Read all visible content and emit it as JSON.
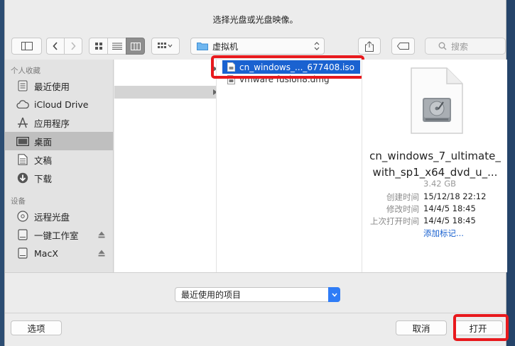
{
  "dialog": {
    "title": "选择光盘或光盘映像。"
  },
  "toolbar": {
    "location": "虚拟机",
    "search_placeholder": "搜索"
  },
  "sidebar": {
    "favorites_header": "个人收藏",
    "favorites": [
      {
        "label": "最近使用",
        "icon": "recents-icon"
      },
      {
        "label": "iCloud Drive",
        "icon": "cloud-icon"
      },
      {
        "label": "应用程序",
        "icon": "applications-icon"
      },
      {
        "label": "桌面",
        "icon": "desktop-icon",
        "selected": true
      },
      {
        "label": "文稿",
        "icon": "documents-icon"
      },
      {
        "label": "下载",
        "icon": "downloads-icon"
      }
    ],
    "devices_header": "设备",
    "devices": [
      {
        "label": "远程光盘",
        "icon": "disc-icon"
      },
      {
        "label": "一键工作室",
        "icon": "drive-icon",
        "ejectable": true
      },
      {
        "label": "MacX",
        "icon": "drive-icon",
        "ejectable": true
      }
    ]
  },
  "columns": {
    "files": [
      {
        "name": "cn_windows_..._677408.iso",
        "selected": true
      },
      {
        "name": "vmware fusion8.dmg",
        "selected": false
      }
    ]
  },
  "preview": {
    "name_line1": "cn_windows_7_ultimate_",
    "name_line2": "with_sp1_x64_dvd_u_...",
    "size": "3.42 GB",
    "created_label": "创建时间",
    "created_value": "15/12/18 22:12",
    "modified_label": "修改时间",
    "modified_value": "14/4/5 18:45",
    "opened_label": "上次打开时间",
    "opened_value": "14/4/5 18:45",
    "add_tags": "添加标记..."
  },
  "format": {
    "selected": "最近使用的项目"
  },
  "buttons": {
    "options": "选项",
    "cancel": "取消",
    "open": "打开"
  },
  "colors": {
    "accent": "#1a62d0",
    "highlight_box": "#e8191d"
  }
}
